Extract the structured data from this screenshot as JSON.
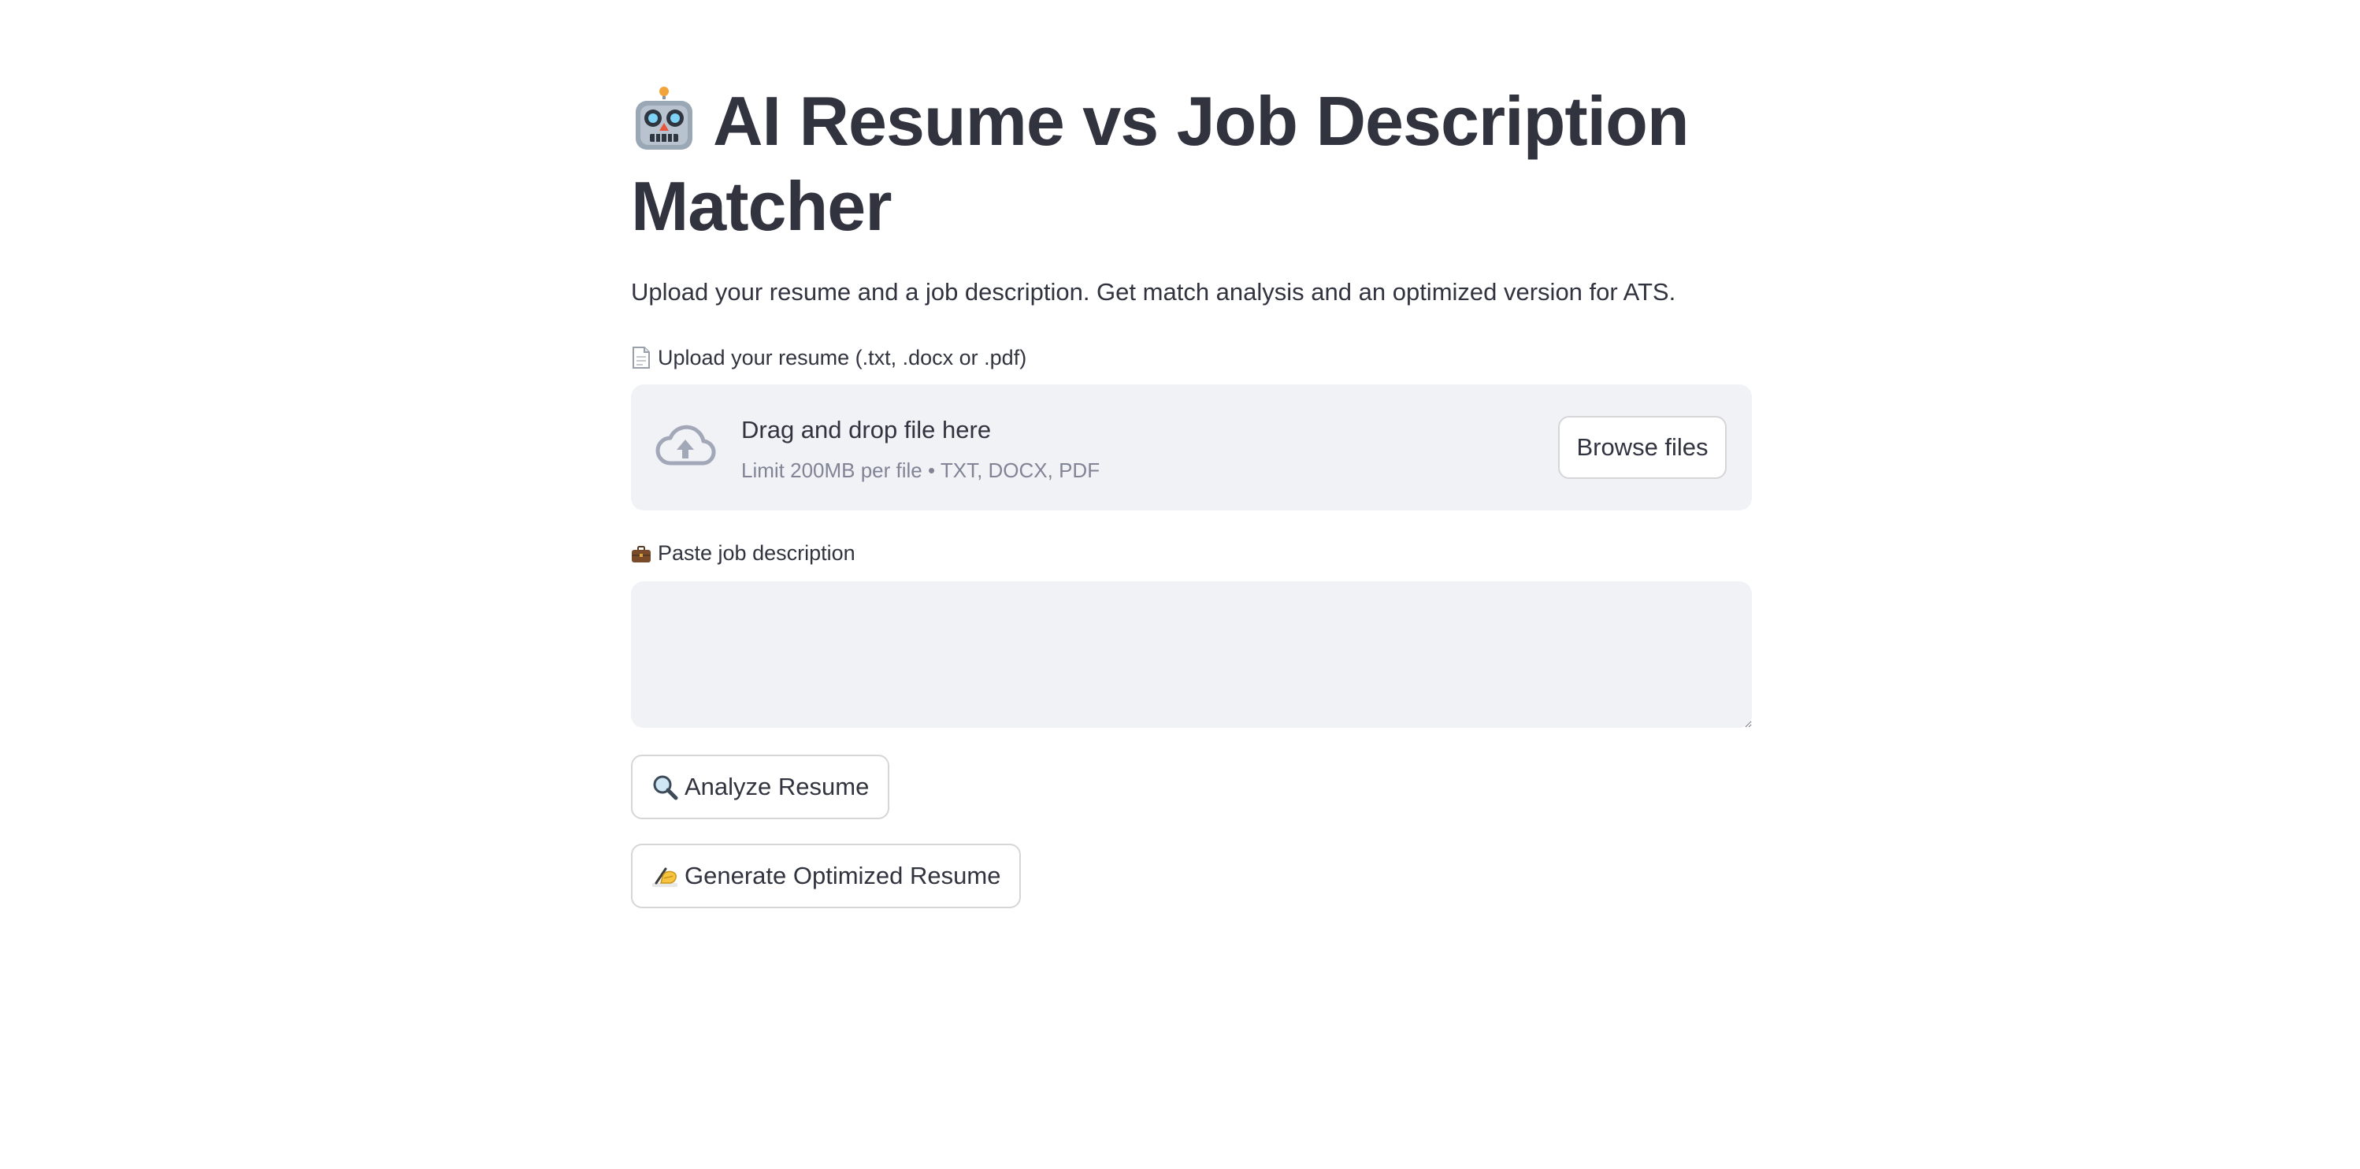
{
  "header": {
    "title": "AI Resume vs Job Description Matcher",
    "title_icon": "robot-icon",
    "subtitle": "Upload your resume and a job description. Get match analysis and an optimized version for ATS."
  },
  "resume_upload": {
    "label": "Upload your resume (.txt, .docx or .pdf)",
    "label_icon": "page-icon",
    "drop_text": "Drag and drop file here",
    "limit_text": "Limit 200MB per file • TXT, DOCX, PDF",
    "browse_label": "Browse files",
    "icon": "cloud-upload-icon"
  },
  "job_description": {
    "label": "Paste job description",
    "label_icon": "briefcase-icon",
    "value": ""
  },
  "actions": {
    "analyze_label": "Analyze Resume",
    "analyze_icon": "magnifier-icon",
    "generate_label": "Generate Optimized Resume",
    "generate_icon": "writing-hand-icon"
  },
  "colors": {
    "text": "#31333f",
    "muted": "#808495",
    "panel_bg": "#f0f2f6",
    "border": "#d6d6d9",
    "icon_gray": "#a3a8b8"
  }
}
